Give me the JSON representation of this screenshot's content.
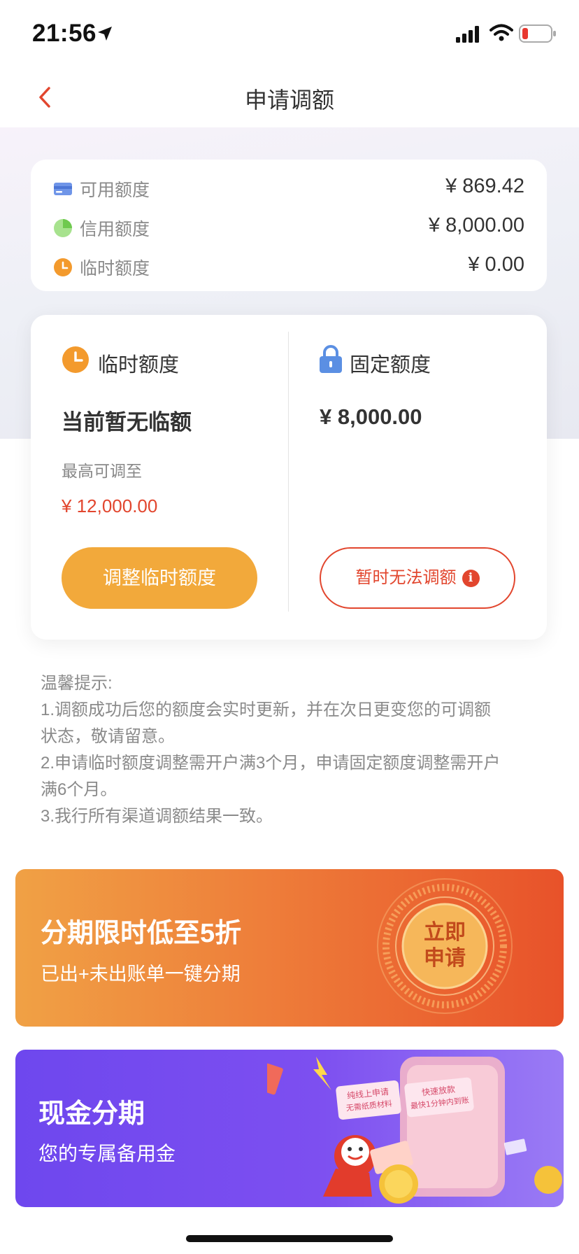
{
  "status": {
    "time": "21:56"
  },
  "nav": {
    "title": "申请调额"
  },
  "summary": {
    "items": [
      {
        "label": "可用额度",
        "value": "¥ 869.42",
        "icon": "card-icon"
      },
      {
        "label": "信用额度",
        "value": "¥ 8,000.00",
        "icon": "pie-icon"
      },
      {
        "label": "临时额度",
        "value": "¥ 0.00",
        "icon": "clock-icon"
      }
    ]
  },
  "temp": {
    "heading": "临时额度",
    "current": "当前暂无临额",
    "max_label": "最高可调至",
    "max_value": "¥ 12,000.00",
    "button": "调整临时额度"
  },
  "fixed": {
    "heading": "固定额度",
    "amount": "¥ 8,000.00",
    "button": "暂时无法调额",
    "info_glyph": "i"
  },
  "tips": {
    "title": "温馨提示:",
    "line1a": "1.调额成功后您的额度会实时更新，并在次日更变您的可调额",
    "line1b": "状态，敬请留意。",
    "line2a": "2.申请临时额度调整需开户满3个月，申请固定额度调整需开户",
    "line2b": "满6个月。",
    "line3": "3.我行所有渠道调额结果一致。"
  },
  "banner1": {
    "title": "分期限时低至5折",
    "subtitle": "已出+未出账单一键分期",
    "seal_line1": "立即",
    "seal_line2": "申请"
  },
  "banner2": {
    "title": "现金分期",
    "subtitle": "您的专属备用金",
    "tag1_line1": "纯线上申请",
    "tag1_line2": "无需纸质材料",
    "tag2_line1": "快速放款",
    "tag2_line2": "最快1分钟内到账"
  },
  "colors": {
    "accent_red": "#e2462e",
    "accent_orange": "#f2a93b",
    "purple": "#6e47ee"
  }
}
